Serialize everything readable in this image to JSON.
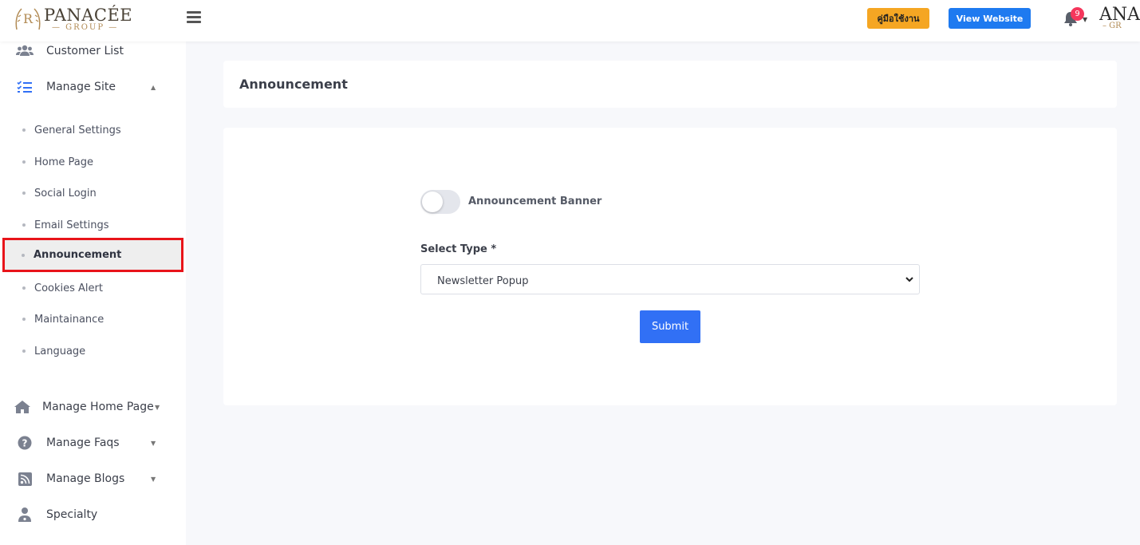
{
  "header": {
    "brand": "PANACÉE",
    "brand_sub": "— GROUP —",
    "manual_button": "คู่มือใช้งาน",
    "view_website_button": "View Website",
    "notification_count": "9",
    "user_logo_text": "ANA",
    "user_logo_sub": "– GR",
    "colors": {
      "manual": "#f5a623",
      "view": "#1e7af0",
      "badge": "#f5365c"
    }
  },
  "sidebar": {
    "customer_list": "Customer List",
    "manage_site": "Manage Site",
    "sub_items": [
      "General Settings",
      "Home Page",
      "Social Login",
      "Email Settings",
      "Announcement",
      "Cookies Alert",
      "Maintainance",
      "Language"
    ],
    "active_item": "Announcement",
    "manage_home_page": "Manage Home Page",
    "manage_faqs": "Manage Faqs",
    "manage_blogs": "Manage Blogs",
    "specialty": "Specialty"
  },
  "main": {
    "title": "Announcement",
    "toggle_label": "Announcement Banner",
    "toggle_on": false,
    "select_label": "Select Type *",
    "select_value": "Newsletter Popup",
    "submit_label": "Submit",
    "accent_color": "#3170f5"
  }
}
